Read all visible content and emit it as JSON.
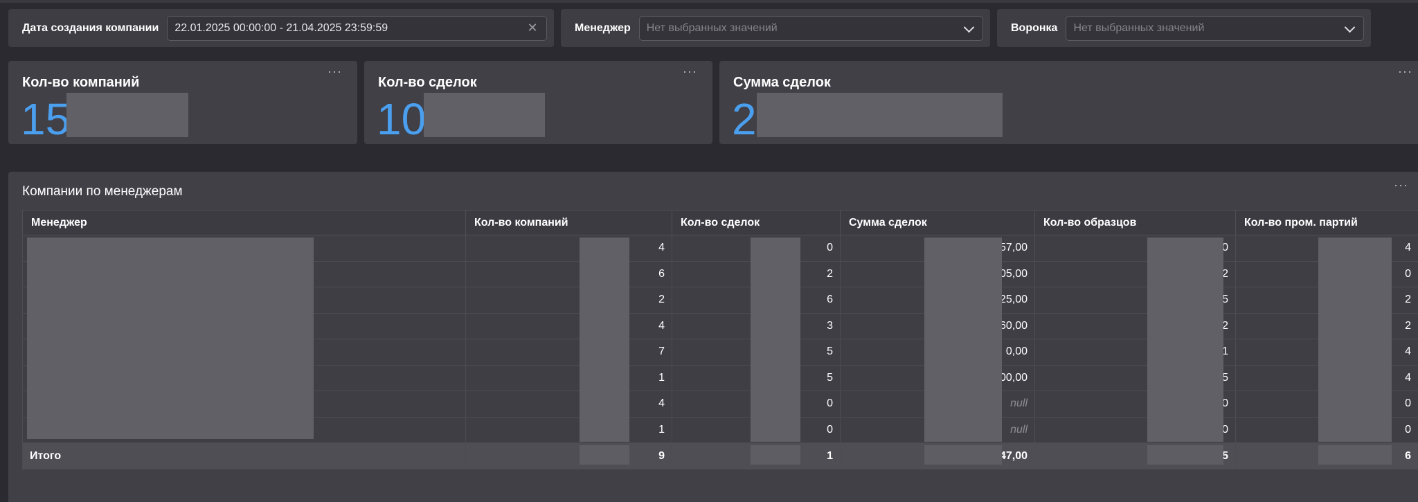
{
  "filters": {
    "date": {
      "label": "Дата создания компании",
      "value": "22.01.2025 00:00:00 - 21.04.2025 23:59:59"
    },
    "manager": {
      "label": "Менеджер",
      "placeholder": "Нет выбранных значений"
    },
    "funnel": {
      "label": "Воронка",
      "placeholder": "Нет выбранных значений"
    }
  },
  "kpis": [
    {
      "title": "Кол-во компаний",
      "value": "15"
    },
    {
      "title": "Кол-во сделок",
      "value": "10"
    },
    {
      "title": "Сумма сделок",
      "value": "2"
    }
  ],
  "menu_glyph": "···",
  "table": {
    "title": "Компании по менеджерам",
    "headers": [
      "Менеджер",
      "Кол-во компаний",
      "Кол-во сделок",
      "Сумма сделок",
      "Кол-во образцов",
      "Кол-во пром. партий"
    ],
    "rows": [
      [
        "",
        "4",
        "0",
        "57,00",
        "0",
        "4"
      ],
      [
        "",
        "6",
        "2",
        "05,00",
        "2",
        "0"
      ],
      [
        "",
        "2",
        "6",
        "25,00",
        "5",
        "2"
      ],
      [
        "",
        "4",
        "3",
        "60,00",
        "2",
        "2"
      ],
      [
        "",
        "7",
        "5",
        "0,00",
        "1",
        "4"
      ],
      [
        "",
        "1",
        "5",
        "00,00",
        "5",
        "4"
      ],
      [
        "",
        "4",
        "0",
        "null",
        "0",
        "0"
      ],
      [
        "",
        "1",
        "0",
        "null",
        "0",
        "0"
      ]
    ],
    "total": [
      "Итого",
      "9",
      "1",
      "47,00",
      "5",
      "6"
    ]
  },
  "colors": {
    "background": "#2b2a30",
    "panel": "#414047",
    "accent": "#4a9fef",
    "mask": "#616066"
  }
}
